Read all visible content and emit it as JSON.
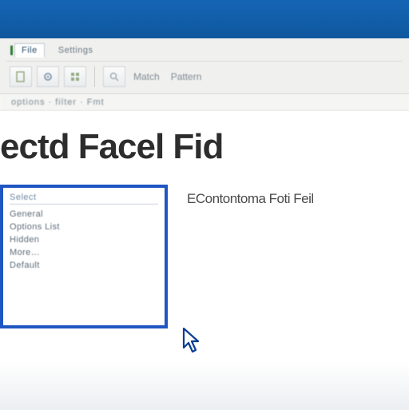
{
  "tabs": {
    "t0": "File",
    "t1": "Settings"
  },
  "toolbar": {
    "l0": "Match",
    "l1": "Pattern"
  },
  "lowerbar": "options · filter · Fmt",
  "heading": "ectd Facel Fid",
  "listbox": {
    "header": "Select",
    "i0": "General",
    "i1": "Options List",
    "i2": "Hidden",
    "i3": "More…",
    "i4": "Default"
  },
  "caption": "EContontoma Foti Feil"
}
